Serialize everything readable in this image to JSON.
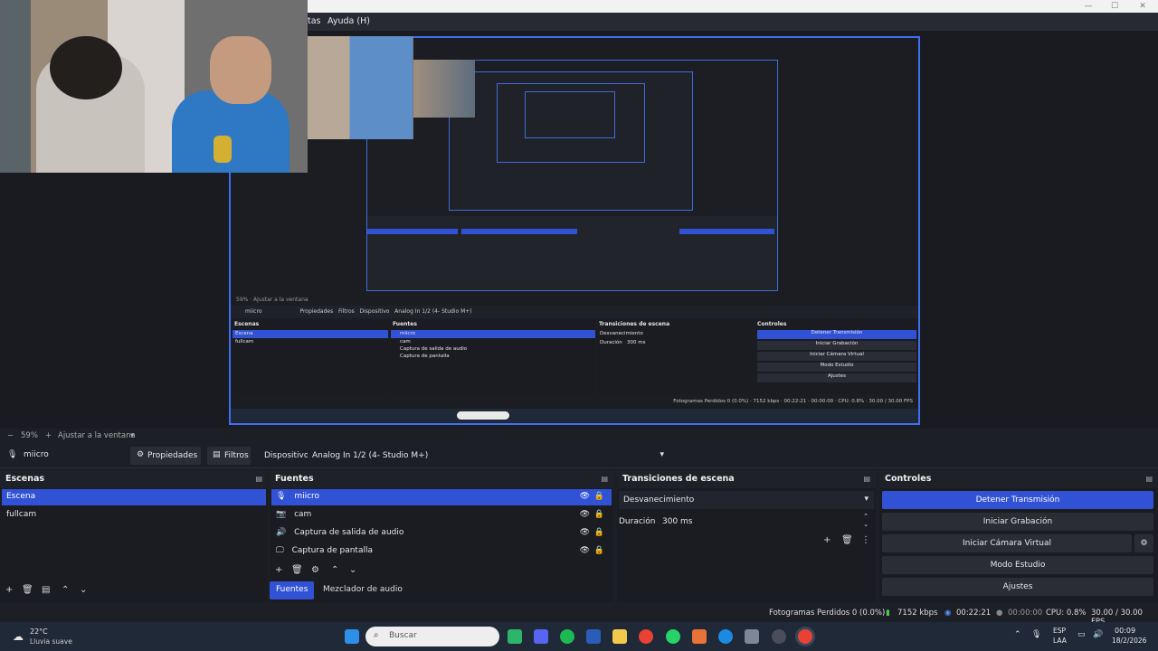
{
  "menu": {
    "partial_item": "tas",
    "help": "Ayuda (H)"
  },
  "zoom": {
    "level": "59%",
    "fit_label": "Ajustar a la ventana"
  },
  "source_bar": {
    "selected_source": "miicro",
    "properties": "Propiedades",
    "filters": "Filtros",
    "device_label": "Dispositivo",
    "device_value": "Analog In 1/2 (4- Studio M+)"
  },
  "scenes": {
    "title": "Escenas",
    "items": [
      "Escena",
      "fullcam"
    ]
  },
  "sources": {
    "title": "Fuentes",
    "items": [
      {
        "label": "miicro",
        "icon": "microphone-icon"
      },
      {
        "label": "cam",
        "icon": "camera-icon"
      },
      {
        "label": "Captura de salida de audio",
        "icon": "speaker-icon"
      },
      {
        "label": "Captura de pantalla",
        "icon": "monitor-icon"
      }
    ],
    "tab_sources": "Fuentes",
    "tab_mixer": "Mezclador de audio"
  },
  "transitions": {
    "title": "Transiciones de escena",
    "selected": "Desvanecimiento",
    "duration_label": "Duración",
    "duration_value": "300 ms"
  },
  "controls": {
    "title": "Controles",
    "stop_stream": "Detener Transmisión",
    "start_recording": "Iniciar Grabación",
    "start_virtual_cam": "Iniciar Cámara Virtual",
    "studio_mode": "Modo Estudio",
    "settings": "Ajustes"
  },
  "status": {
    "dropped_frames": "Fotogramas Perdidos 0 (0.0%)",
    "bitrate": "7152 kbps",
    "stream_time": "00:22:21",
    "record_time": "00:00:00",
    "cpu": "CPU: 0.8%",
    "fps": "30.00 / 30.00 FPS"
  },
  "taskbar": {
    "weather_temp": "22°C",
    "weather_desc": "Lluvia suave",
    "search_placeholder": "Buscar",
    "lang_top": "ESP",
    "lang_bottom": "LAA",
    "time": "00:09",
    "date": "18/2/2026"
  },
  "colors": {
    "accent": "#3252d6",
    "canvas_border": "#3d6ff0"
  }
}
